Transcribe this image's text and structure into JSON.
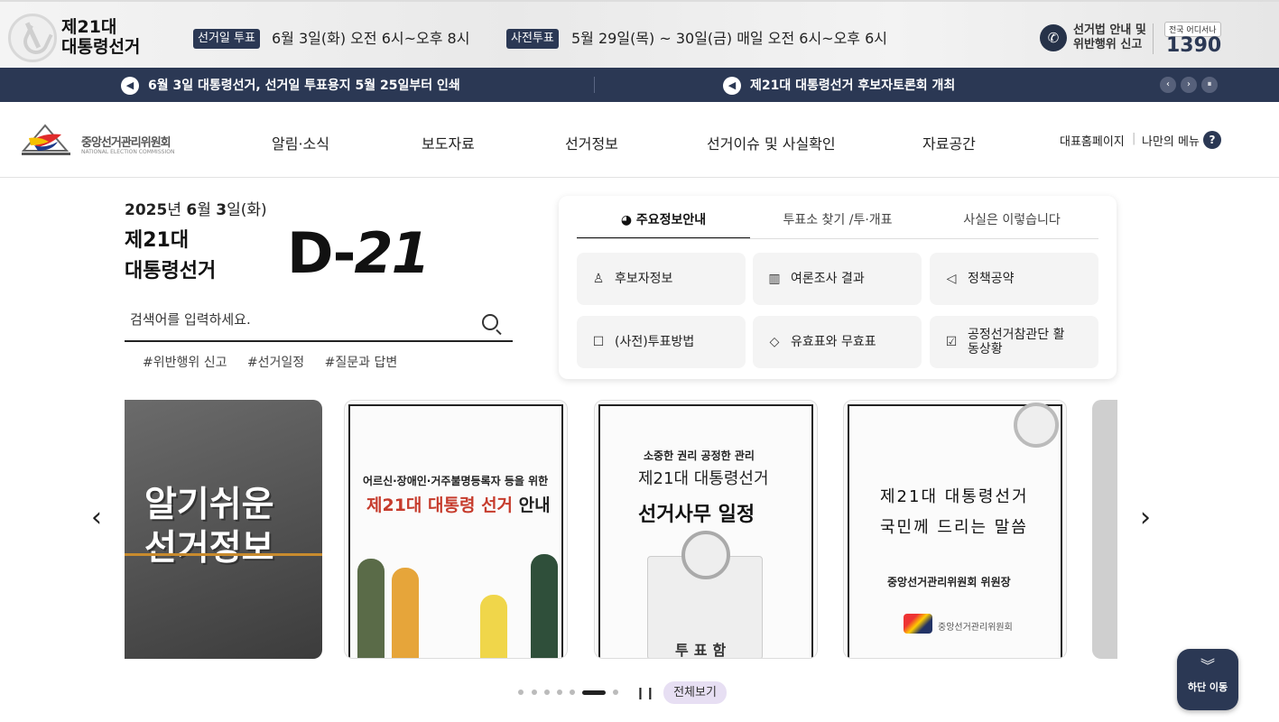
{
  "topbar": {
    "election_title_line1": "제21대",
    "election_title_line2": "대통령선거",
    "election_day_tag": "선거일 투표",
    "election_day_date": "6월 3일(화) 오전 6시~오후 8시",
    "early_vote_tag": "사전투표",
    "early_vote_date": "5월 29일(목) ~ 30일(금) 매일 오전 6시~오후 6시",
    "report_line1": "선거법 안내 및",
    "report_line2": "위반행위 신고",
    "hotline_badge": "전국 어디서나",
    "hotline_number": "1390"
  },
  "notices": {
    "item1": "6월 3일 대통령선거, 선거일 투표용지 5월 25일부터 인쇄",
    "item2": "제21대 대통령선거 후보자토론회 개최",
    "prev": "‹",
    "next": "›",
    "pause": "⏸"
  },
  "nav": {
    "logo_name": "중앙선거관리위원회",
    "logo_en": "NATIONAL ELECTION COMMISSION",
    "menu": [
      "알림·소식",
      "보도자료",
      "선거정보",
      "선거이슈 및 사실확인",
      "자료공간"
    ],
    "home_link": "대표홈페이지",
    "my_menu": "나만의 메뉴",
    "help": "?"
  },
  "hero": {
    "date_year": "2025",
    "date_rest": "년 ",
    "date_month": "6",
    "date_m": "월 ",
    "date_day": "3",
    "date_tail": "일(화)",
    "title_line1": "제21대",
    "title_line2": "대통령선거",
    "dday_prefix": "D-",
    "dday_num": "21",
    "search_placeholder": "검색어를 입력하세요.",
    "hashtags": [
      "#위반행위 신고",
      "#선거일정",
      "#질문과 답변"
    ]
  },
  "panel": {
    "tabs": [
      "주요정보안내",
      "투표소 찾기 /투·개표",
      "사실은 이렇습니다"
    ],
    "buttons": [
      {
        "label": "후보자정보",
        "icon": "person-icon"
      },
      {
        "label": "여론조사 결과",
        "icon": "bar-chart-icon"
      },
      {
        "label": "정책공약",
        "icon": "megaphone-icon"
      },
      {
        "label": "(사전)투표방법",
        "icon": "ballot-box-icon"
      },
      {
        "label": "유효표와 무효표",
        "icon": "eraser-icon"
      },
      {
        "label": "공정선거참관단 활동상황",
        "icon": "checklist-icon"
      }
    ]
  },
  "carousel": {
    "card1": {
      "line1": "알기쉬운",
      "line2": "선거정보"
    },
    "card2": {
      "sub": "어르신·장애인·거주불명등록자 등을 위한",
      "title_red": "제21대 대통령 선거",
      "title_black": " 안내"
    },
    "card3": {
      "sub": "소중한 권리 공정한 관리",
      "t1": "제21대 대통령선거",
      "t2": "선거사무 일정",
      "box_label": "투표함"
    },
    "card4": {
      "t1": "제21대 대통령선거",
      "t2": "국민께 드리는 말씀",
      "t3": "중앙선거관리위원회 위원장",
      "t4": "중앙선거관리위원회"
    },
    "prev": "‹",
    "next": "›",
    "pause": "❙❙",
    "view_all": "전체보기",
    "active_index": 5,
    "total": 7
  },
  "scroll_bottom": {
    "icon": "double-chevron-down-icon",
    "label": "하단 이동"
  }
}
